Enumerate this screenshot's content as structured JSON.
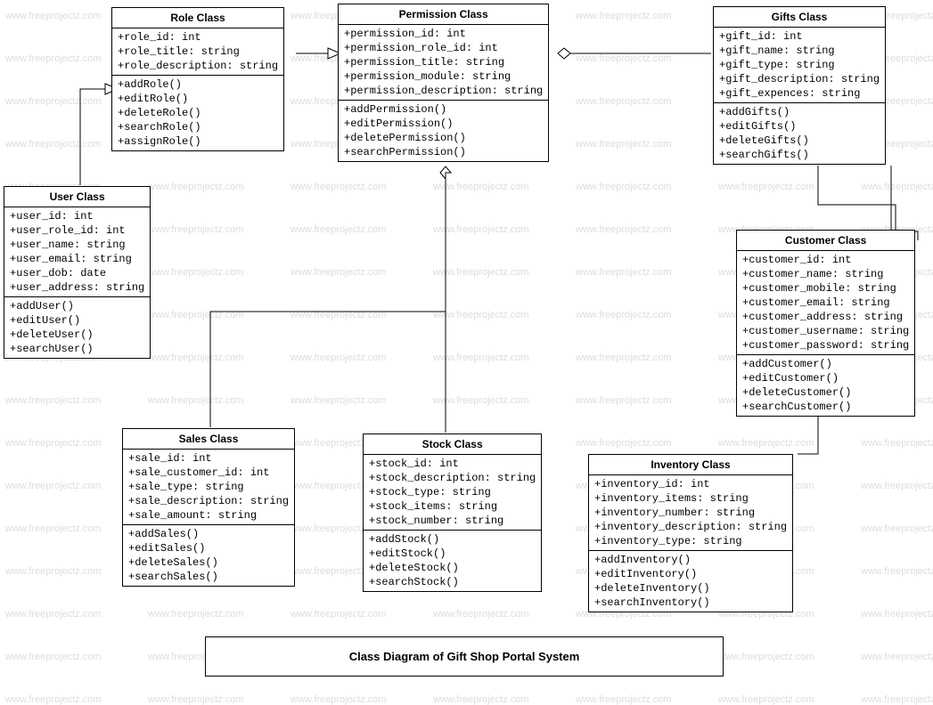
{
  "watermark": "www.freeprojectz.com",
  "title": "Class Diagram of Gift Shop Portal System",
  "classes": {
    "role": {
      "name": "Role Class",
      "attrs": [
        "+role_id: int",
        "+role_title: string",
        "+role_description: string"
      ],
      "ops": [
        "+addRole()",
        "+editRole()",
        "+deleteRole()",
        "+searchRole()",
        "+assignRole()"
      ]
    },
    "permission": {
      "name": "Permission Class",
      "attrs": [
        "+permission_id: int",
        "+permission_role_id: int",
        "+permission_title: string",
        "+permission_module: string",
        "+permission_description: string"
      ],
      "ops": [
        "+addPermission()",
        "+editPermission()",
        "+deletePermission()",
        "+searchPermission()"
      ]
    },
    "gifts": {
      "name": "Gifts Class",
      "attrs": [
        "+gift_id: int",
        "+gift_name: string",
        "+gift_type: string",
        "+gift_description: string",
        "+gift_expences: string"
      ],
      "ops": [
        "+addGifts()",
        "+editGifts()",
        "+deleteGifts()",
        "+searchGifts()"
      ]
    },
    "user": {
      "name": "User Class",
      "attrs": [
        "+user_id: int",
        "+user_role_id: int",
        "+user_name: string",
        "+user_email: string",
        "+user_dob: date",
        "+user_address: string"
      ],
      "ops": [
        "+addUser()",
        "+editUser()",
        "+deleteUser()",
        "+searchUser()"
      ]
    },
    "customer": {
      "name": "Customer Class",
      "attrs": [
        "+customer_id: int",
        "+customer_name: string",
        "+customer_mobile: string",
        "+customer_email: string",
        "+customer_address: string",
        "+customer_username: string",
        "+customer_password: string"
      ],
      "ops": [
        "+addCustomer()",
        "+editCustomer()",
        "+deleteCustomer()",
        "+searchCustomer()"
      ]
    },
    "sales": {
      "name": "Sales Class",
      "attrs": [
        "+sale_id: int",
        "+sale_customer_id: int",
        "+sale_type: string",
        "+sale_description: string",
        "+sale_amount: string"
      ],
      "ops": [
        "+addSales()",
        "+editSales()",
        "+deleteSales()",
        "+searchSales()"
      ]
    },
    "stock": {
      "name": "Stock Class",
      "attrs": [
        "+stock_id: int",
        "+stock_description: string",
        "+stock_type: string",
        "+stock_items: string",
        "+stock_number: string"
      ],
      "ops": [
        "+addStock()",
        "+editStock()",
        "+deleteStock()",
        "+searchStock()"
      ]
    },
    "inventory": {
      "name": "Inventory Class",
      "attrs": [
        "+inventory_id: int",
        "+inventory_items: string",
        "+inventory_number: string",
        "+inventory_description: string",
        "+inventory_type: string"
      ],
      "ops": [
        "+addInventory()",
        "+editInventory()",
        "+deleteInventory()",
        "+searchInventory()"
      ]
    }
  },
  "relations": [
    {
      "from": "user",
      "to": "role",
      "type": "generalization"
    },
    {
      "from": "role",
      "to": "permission",
      "type": "generalization"
    },
    {
      "from": "permission",
      "to": "gifts",
      "type": "aggregation"
    },
    {
      "from": "permission",
      "to": "sales",
      "type": "aggregation"
    },
    {
      "from": "permission",
      "to": "stock",
      "type": "aggregation"
    },
    {
      "from": "gifts",
      "to": "customer",
      "type": "association"
    },
    {
      "from": "customer",
      "to": "inventory",
      "type": "association"
    }
  ]
}
